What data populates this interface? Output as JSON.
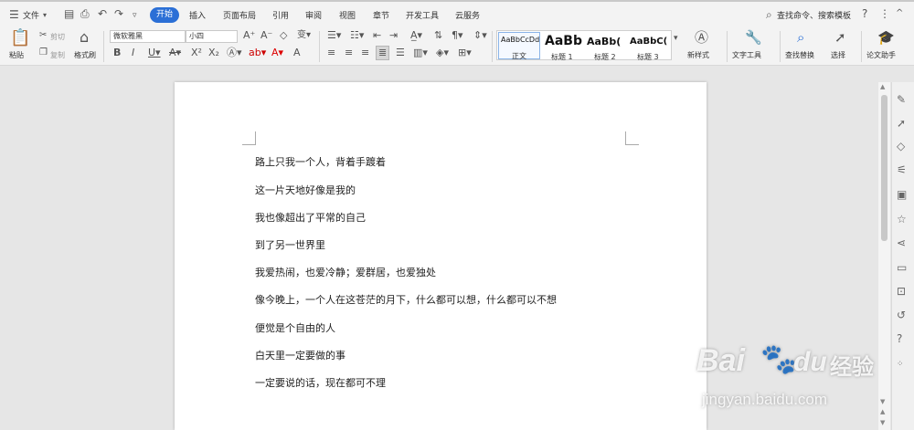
{
  "menubar": {
    "file": "文件",
    "tabs": [
      "开始",
      "插入",
      "页面布局",
      "引用",
      "审阅",
      "视图",
      "章节",
      "开发工具",
      "云服务"
    ],
    "search": "查找命令、搜索模板"
  },
  "toolbar": {
    "paste": "粘贴",
    "cut": "剪切",
    "copy": "复制",
    "format_painter": "格式刷",
    "font_name": "微软雅黑",
    "font_size": "小四",
    "styles": [
      {
        "preview": "AaBbCcDd",
        "label": "正文"
      },
      {
        "preview": "AaBb",
        "label": "标题 1"
      },
      {
        "preview": "AaBb(",
        "label": "标题 2"
      },
      {
        "preview": "AaBbC(",
        "label": "标题 3"
      }
    ],
    "new_style": "新样式",
    "text_tools": "文字工具",
    "find_replace": "查找替换",
    "select": "选择",
    "paper_assistant": "论文助手"
  },
  "document": {
    "lines": [
      "路上只我一个人，背着手踱着",
      "这一片天地好像是我的",
      "我也像超出了平常的自己",
      "到了另一世界里",
      "我爱热闹，也爱冷静；爱群居，也爱独处",
      "像今晚上，一个人在这苍茫的月下，什么都可以想，什么都可以不想",
      "便觉是个自由的人",
      "白天里一定要做的事",
      "一定要说的话，现在都可不理"
    ]
  },
  "watermark": {
    "brand": "Bai",
    "brand_cn": "经验",
    "url": "jingyan.baidu.com"
  },
  "icons": {
    "menu": "hamburger-icon",
    "search": "search-icon",
    "help": "question-icon",
    "more": "more-icon",
    "collapse": "chevron-up-icon"
  }
}
